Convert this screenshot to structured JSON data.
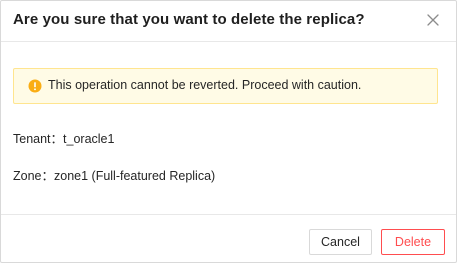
{
  "dialog": {
    "title": "Are you sure that you want to delete the replica?",
    "close_icon": "close-icon"
  },
  "alert": {
    "icon": "warning-circle-icon",
    "message": "This operation cannot be reverted. Proceed with caution.",
    "colors": {
      "background": "#fffbe6",
      "border": "#ffe58f",
      "icon": "#faad14"
    }
  },
  "details": {
    "tenant_label": "Tenant：",
    "tenant_value": "t_oracle1",
    "zone_label": "Zone：",
    "zone_value": "zone1 (Full-featured Replica)"
  },
  "footer": {
    "cancel_label": "Cancel",
    "delete_label": "Delete",
    "delete_color": "#ff4d4f"
  }
}
